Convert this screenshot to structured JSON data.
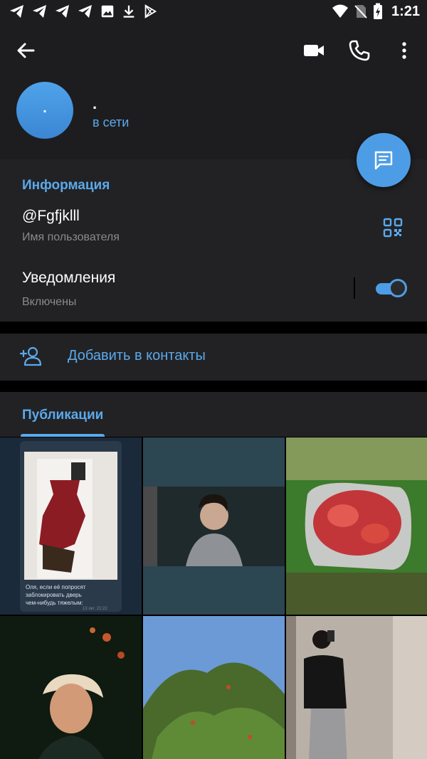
{
  "status_bar": {
    "time": "1:21",
    "icons": [
      "telegram-icon",
      "telegram-icon",
      "telegram-icon",
      "telegram-icon",
      "image-icon",
      "download-icon",
      "play-store-icon",
      "wifi-icon",
      "no-sim-icon",
      "battery-charging-icon"
    ]
  },
  "header": {
    "avatar_initial": ".",
    "name": ".",
    "status": "в сети",
    "actions": [
      "back-arrow-icon",
      "video-call-icon",
      "phone-icon",
      "more-vert-icon"
    ],
    "avatar_color": "#4a9be6"
  },
  "info": {
    "section_title": "Информация",
    "username": "@Fgfjklll",
    "username_label": "Имя пользователя",
    "notifications": "Уведомления",
    "notifications_status": "Включены",
    "notifications_enabled": true
  },
  "add_contact": {
    "label": "Добавить в контакты"
  },
  "publications": {
    "tab_label": "Публикации"
  },
  "grid": {
    "c1_caption_line1": "Оля, если её попросят",
    "c1_caption_line2": "заблокировать дверь",
    "c1_caption_line3": "чем-нибудь тяжелым:",
    "c1_meta": "13 окт. 21:22"
  },
  "colors": {
    "accent": "#5ba9ec",
    "background": "#222224",
    "header": "#1d1d1f",
    "fab": "#4d9de6"
  }
}
